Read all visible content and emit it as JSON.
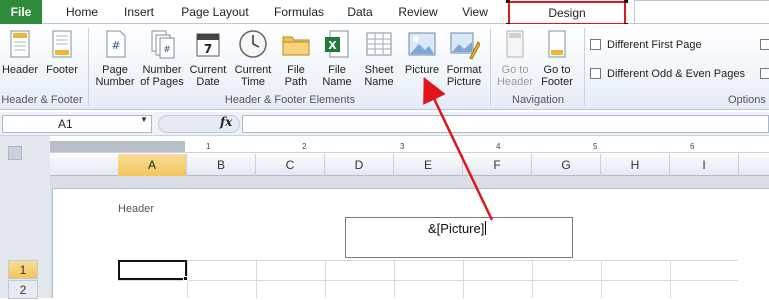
{
  "tabs": {
    "file": "File",
    "home": "Home",
    "insert": "Insert",
    "page_layout": "Page Layout",
    "formulas": "Formulas",
    "data": "Data",
    "review": "Review",
    "view": "View",
    "design": "Design"
  },
  "ribbon": {
    "header_footer_group": {
      "label": "Header & Footer",
      "header_btn": "Header",
      "footer_btn": "Footer"
    },
    "elements_group": {
      "label": "Header & Footer Elements",
      "page_number": [
        "Page",
        "Number"
      ],
      "number_of_pages": [
        "Number",
        "of Pages"
      ],
      "current_date": [
        "Current",
        "Date"
      ],
      "current_time": [
        "Current",
        "Time"
      ],
      "file_path": [
        "File",
        "Path"
      ],
      "file_name": [
        "File",
        "Name"
      ],
      "sheet_name": [
        "Sheet",
        "Name"
      ],
      "picture": "Picture",
      "format_picture": [
        "Format",
        "Picture"
      ]
    },
    "navigation_group": {
      "label": "Navigation",
      "goto_header": [
        "Go to",
        "Header"
      ],
      "goto_footer": [
        "Go to",
        "Footer"
      ]
    },
    "options_group": {
      "label": "Options",
      "different_first_page": "Different First Page",
      "different_odd_even": "Different Odd & Even Pages"
    }
  },
  "formula_bar": {
    "name_box": "A1",
    "fx": "fx",
    "value": ""
  },
  "ruler": [
    "1",
    "2",
    "3",
    "4",
    "5",
    "6"
  ],
  "columns": [
    "A",
    "B",
    "C",
    "D",
    "E",
    "F",
    "G",
    "H",
    "I"
  ],
  "rows": [
    "1",
    "2"
  ],
  "page": {
    "header_label": "Header",
    "center_header_code": "&[Picture]"
  },
  "colors": {
    "file_tab": "#2d8b3a",
    "highlight_box": "#e0161c",
    "arrow": "#e0161c",
    "selected_header": "#f3c45a"
  }
}
